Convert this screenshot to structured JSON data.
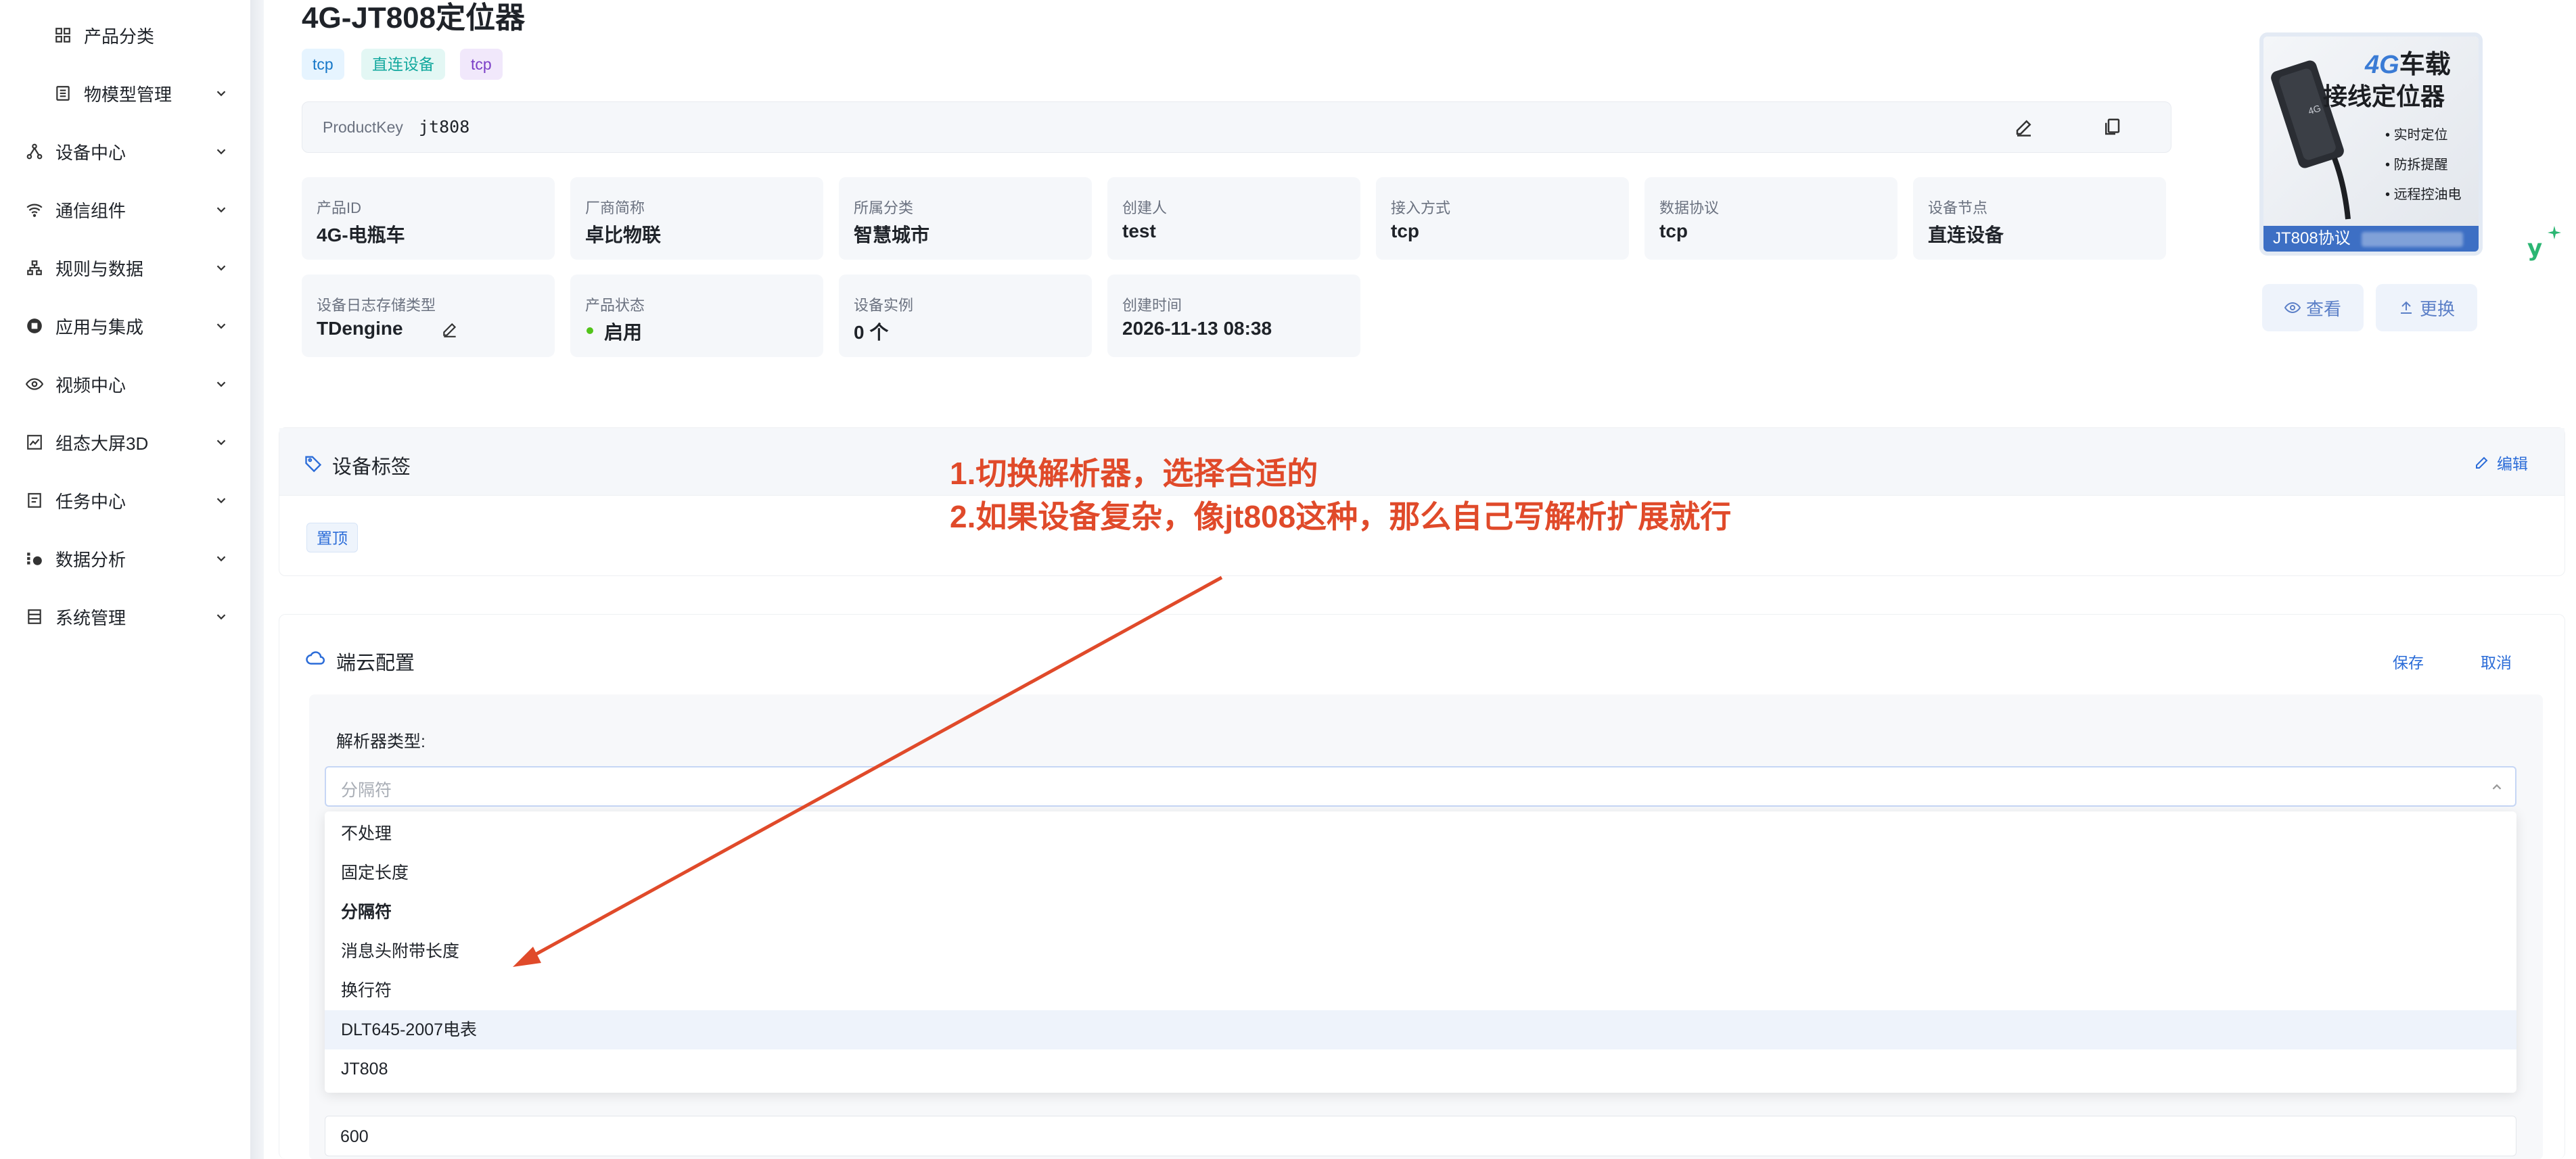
{
  "sidebar": {
    "items": [
      {
        "label": "产品分类",
        "icon": "grid-icon"
      },
      {
        "label": "物模型管理",
        "icon": "list-icon"
      },
      {
        "label": "设备中心",
        "icon": "device-network-icon"
      },
      {
        "label": "通信组件",
        "icon": "wifi-icon"
      },
      {
        "label": "规则与数据",
        "icon": "rule-tree-icon"
      },
      {
        "label": "应用与集成",
        "icon": "app-integration-icon"
      },
      {
        "label": "视频中心",
        "icon": "eye-icon"
      },
      {
        "label": "组态大屏3D",
        "icon": "chart-icon"
      },
      {
        "label": "任务中心",
        "icon": "task-icon"
      },
      {
        "label": "数据分析",
        "icon": "analysis-icon"
      },
      {
        "label": "系统管理",
        "icon": "system-icon"
      }
    ]
  },
  "product": {
    "title": "4G-JT808定位器",
    "tags": [
      "tcp",
      "直连设备",
      "tcp"
    ],
    "product_key_label": "ProductKey",
    "product_key": "jt808"
  },
  "info": {
    "row1": [
      {
        "label": "产品ID",
        "value": "4G-电瓶车"
      },
      {
        "label": "厂商简称",
        "value": "卓比物联"
      },
      {
        "label": "所属分类",
        "value": "智慧城市"
      },
      {
        "label": "创建人",
        "value": "test"
      },
      {
        "label": "接入方式",
        "value": "tcp"
      },
      {
        "label": "数据协议",
        "value": "tcp"
      },
      {
        "label": "设备节点",
        "value": "直连设备"
      }
    ],
    "row2": [
      {
        "label": "设备日志存储类型",
        "value": "TDengine"
      },
      {
        "label": "产品状态",
        "value": "启用"
      },
      {
        "label": "设备实例",
        "value": "0 个"
      },
      {
        "label": "创建时间",
        "value": "2026-11-13 08:38"
      }
    ]
  },
  "product_image": {
    "line1_a": "4G",
    "line1_b": "车载",
    "line2": "接线定位器",
    "features": [
      "实时定位",
      "防拆提醒",
      "远程控油电"
    ],
    "footer": "JT808协议",
    "device_text": "4G"
  },
  "image_actions": {
    "view": "查看",
    "replace": "更换"
  },
  "tags_section": {
    "title": "设备标签",
    "edit": "编辑",
    "tag": "置顶"
  },
  "cloud_section": {
    "title": "端云配置",
    "save": "保存",
    "cancel": "取消",
    "parser_label": "解析器类型:",
    "parser_placeholder": "分隔符",
    "parser_options": [
      "不处理",
      "固定长度",
      "分隔符",
      "消息头附带长度",
      "换行符",
      "DLT645-2007电表",
      "JT808"
    ],
    "selected_option": "分隔符",
    "hovered_option": "DLT645-2007电表",
    "next_value": "600"
  },
  "annotation": {
    "line1": "1.切换解析器，选择合适的",
    "line2": "2.如果设备复杂，像jt808这种，那么自己写解析扩展就行"
  },
  "colors": {
    "accent": "#2b6cd8",
    "annotation": "#e04a2a",
    "status_green": "#52c41a"
  }
}
